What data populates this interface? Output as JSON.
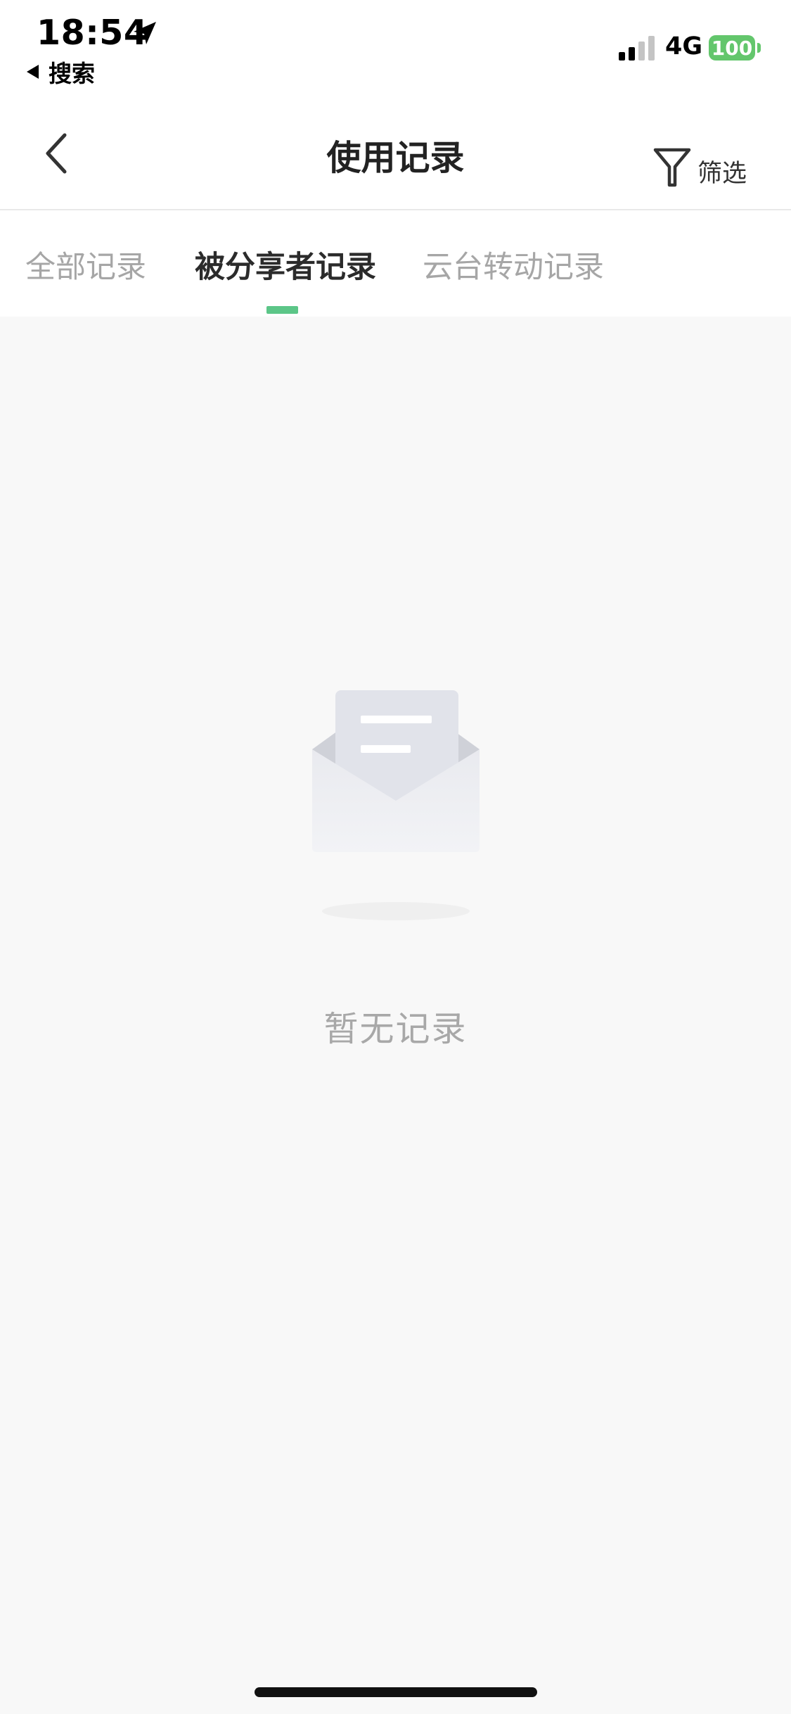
{
  "status_bar": {
    "time": "18:54",
    "back_app_label": "搜索",
    "network": "4G",
    "battery": "100",
    "location_icon": "location-arrow-icon",
    "signal_icon": "cellular-signal-icon"
  },
  "nav": {
    "title": "使用记录",
    "back_icon": "chevron-left-icon",
    "filter_label": "筛选",
    "filter_icon": "funnel-icon"
  },
  "tabs": [
    {
      "label": "全部记录",
      "active": false
    },
    {
      "label": "被分享者记录",
      "active": true
    },
    {
      "label": "云台转动记录",
      "active": false
    }
  ],
  "empty_state": {
    "icon": "empty-envelope-icon",
    "text": "暂无记录"
  },
  "colors": {
    "accent": "#5cc688",
    "battery": "#63c66c",
    "background": "#f8f8f8"
  }
}
